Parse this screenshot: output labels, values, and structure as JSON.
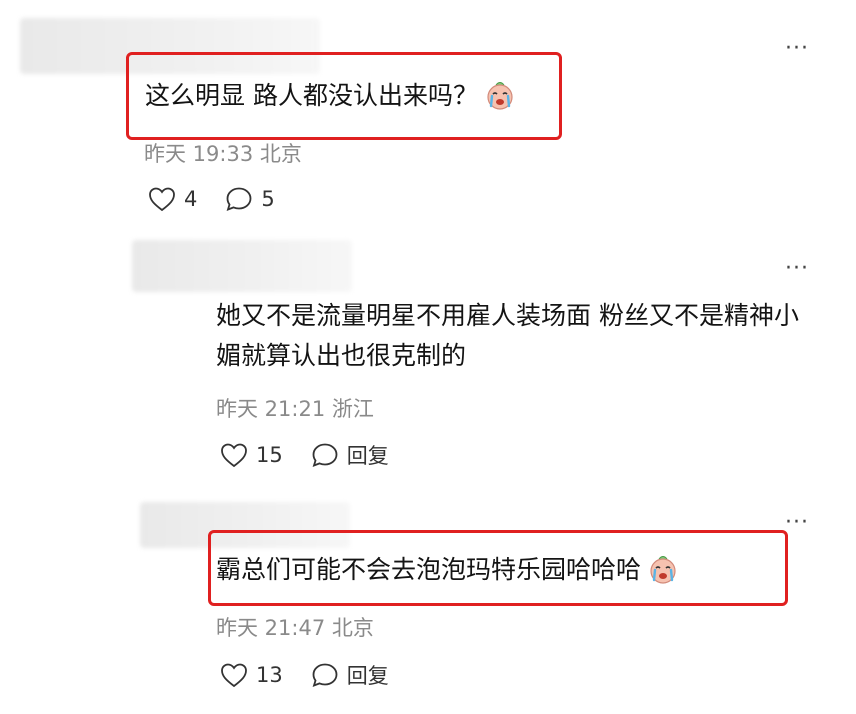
{
  "comments": [
    {
      "text": "这么明显 路人都没认出来吗？",
      "emoji": "crying-face-icon",
      "time": "昨天 19:33 北京",
      "like_count": "4",
      "reply_count": "5"
    },
    {
      "text": "她又不是流量明星不用雇人装场面 粉丝又不是精神小媚就算认出也很克制的",
      "time": "昨天 21:21 浙江",
      "like_count": "15",
      "reply_label": "回复"
    },
    {
      "text": "霸总们可能不会去泡泡玛特乐园哈哈哈",
      "emoji": "crying-face-icon",
      "time": "昨天 21:47 北京",
      "like_count": "13",
      "reply_label": "回复"
    }
  ],
  "more_label": "···",
  "highlight_color": "#e02020"
}
